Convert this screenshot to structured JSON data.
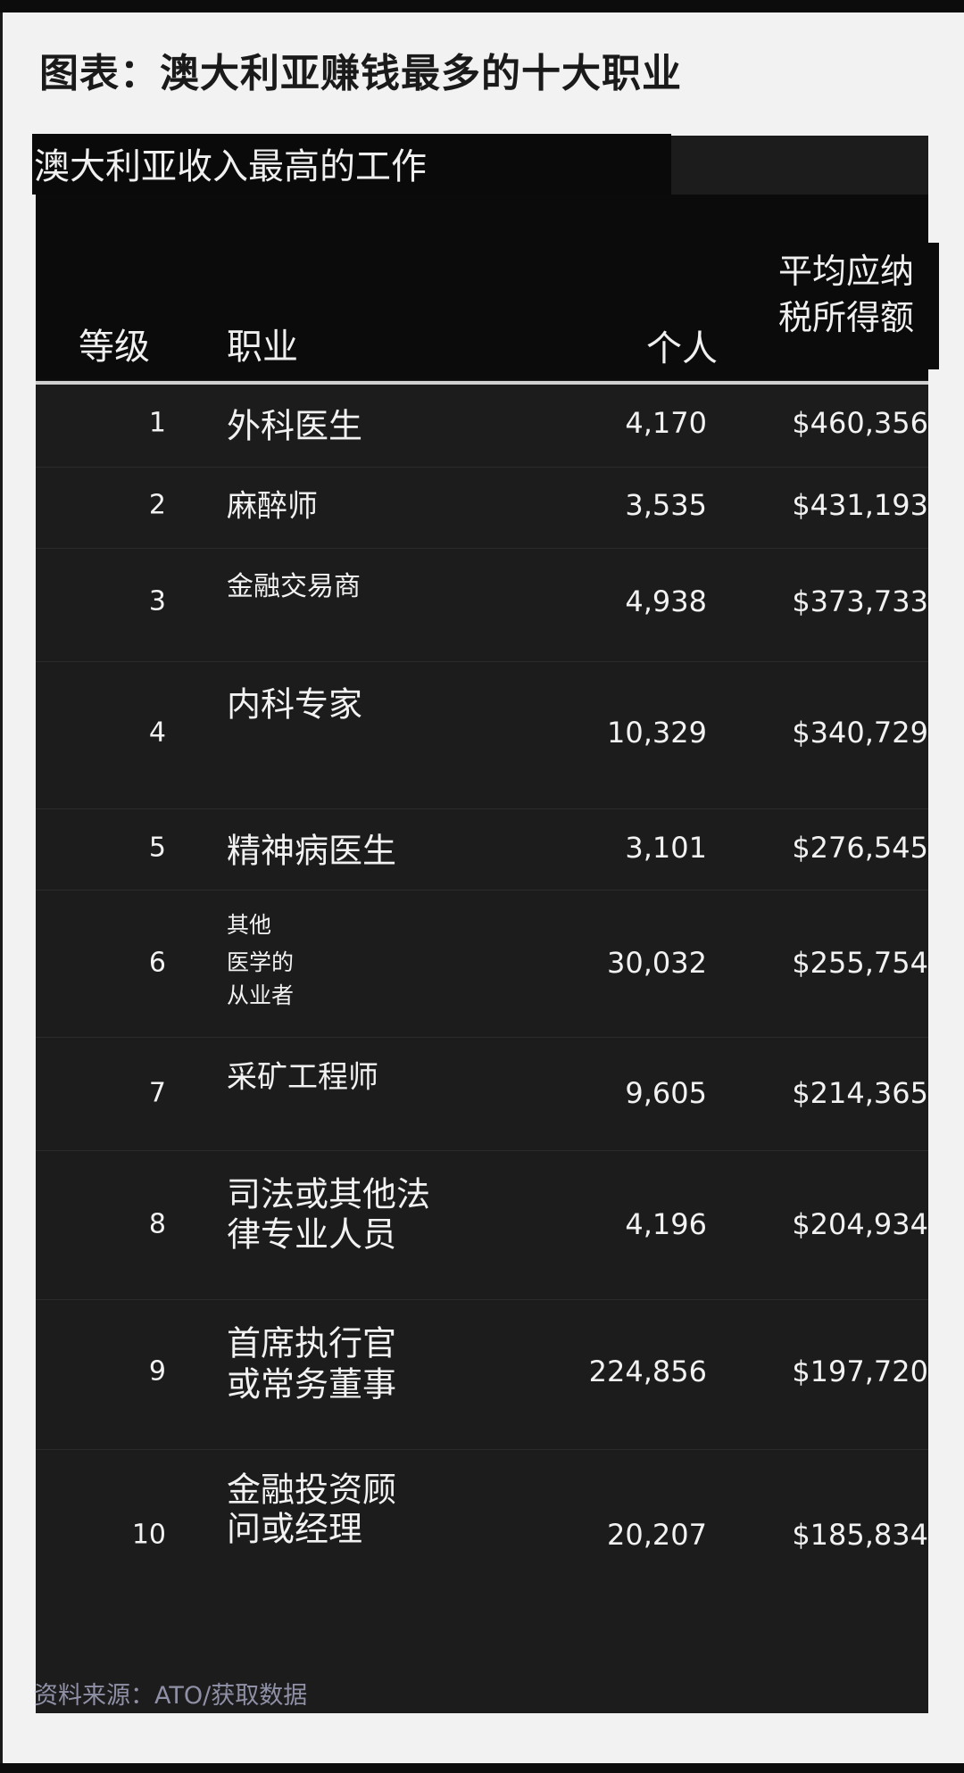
{
  "page_title": "图表：澳大利亚赚钱最多的十大职业",
  "table_title": "澳大利亚收入最高的工作",
  "headers": {
    "rank": "等级",
    "occupation": "职业",
    "count": "个人",
    "income_line1": "平均应纳",
    "income_line2": "税所得额"
  },
  "source": "资料来源：ATO/获取数据",
  "colors": {
    "panel": "#1c1c1c",
    "header": "#0b0b0b",
    "text": "#f2f2f2",
    "source": "#8f90a6",
    "background": "#f2f2f2"
  },
  "chart_data": {
    "type": "table",
    "columns": [
      "等级",
      "职业",
      "个人",
      "平均应纳税所得额"
    ],
    "rows": [
      {
        "rank": "1",
        "occupation": [
          "外科医生"
        ],
        "count": "4,170",
        "income": "$460,356"
      },
      {
        "rank": "2",
        "occupation": [
          "麻醉师"
        ],
        "count": "3,535",
        "income": "$431,193"
      },
      {
        "rank": "3",
        "occupation": [
          "金融交易商"
        ],
        "count": "4,938",
        "income": "$373,733"
      },
      {
        "rank": "4",
        "occupation": [
          "内科专家"
        ],
        "count": "10,329",
        "income": "$340,729"
      },
      {
        "rank": "5",
        "occupation": [
          "精神病医生"
        ],
        "count": "3,101",
        "income": "$276,545"
      },
      {
        "rank": "6",
        "occupation": [
          "其他",
          "医学的",
          "从业者"
        ],
        "count": "30,032",
        "income": "$255,754"
      },
      {
        "rank": "7",
        "occupation": [
          "采矿工程师"
        ],
        "count": "9,605",
        "income": "$214,365"
      },
      {
        "rank": "8",
        "occupation": [
          "司法或其他法",
          "律专业人员"
        ],
        "count": "4,196",
        "income": "$204,934"
      },
      {
        "rank": "9",
        "occupation": [
          "首席执行官",
          "或常务董事"
        ],
        "count": "224,856",
        "income": "$197,720"
      },
      {
        "rank": "10",
        "occupation": [
          "金融投资顾",
          "问或经理"
        ],
        "count": "20,207",
        "income": "$185,834"
      }
    ]
  }
}
